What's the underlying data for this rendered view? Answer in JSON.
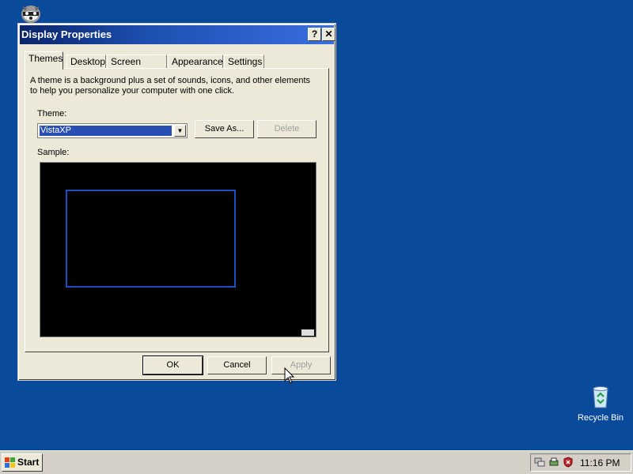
{
  "desktop": {
    "background_color": "#0a4a9a",
    "icons": {
      "top_icon": "raccoon-shortcut-icon",
      "recycle_bin_label": "Recycle Bin"
    }
  },
  "window": {
    "title": "Display Properties",
    "help_glyph": "?",
    "close_glyph": "✕",
    "tabs": [
      {
        "label": "Themes",
        "active": true
      },
      {
        "label": "Desktop"
      },
      {
        "label": "Screen Saver"
      },
      {
        "label": "Appearance"
      },
      {
        "label": "Settings"
      }
    ],
    "description": "A theme is a background plus a set of sounds, icons, and other elements to help you personalize your computer with one click.",
    "theme_label": "Theme:",
    "theme_value": "VistaXP",
    "save_as_label": "Save As...",
    "delete_label": "Delete",
    "sample_label": "Sample:",
    "ok_label": "OK",
    "cancel_label": "Cancel",
    "apply_label": "Apply"
  },
  "taskbar": {
    "start_label": "Start",
    "clock": "11:16 PM",
    "tray_icons": [
      "network-icon",
      "printer-icon",
      "security-shield-icon"
    ]
  }
}
